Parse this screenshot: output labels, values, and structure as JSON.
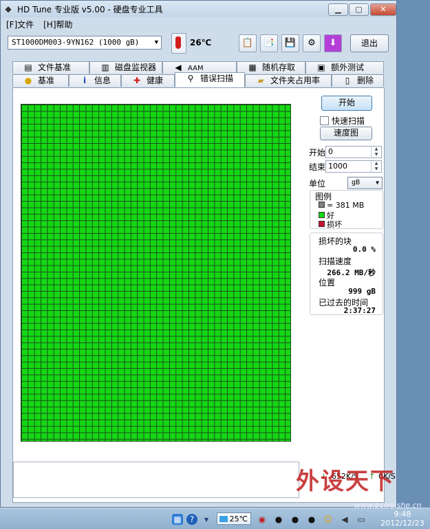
{
  "window": {
    "title": "HD Tune 专业版 v5.00 - 硬盘专业工具",
    "min_label": "▁",
    "max_label": "▢",
    "close_label": "✕"
  },
  "menu": [
    {
      "label": "[F]文件"
    },
    {
      "label": "[H]帮助"
    }
  ],
  "toolbar": {
    "drive": "ST1000DM003-9YN162 (1000 gB)",
    "temperature": "26℃",
    "exit_label": "退出"
  },
  "tabs_row1": [
    {
      "label": "文件基准",
      "icon": "document-icon"
    },
    {
      "label": "磁盘监视器",
      "icon": "chart-icon"
    },
    {
      "label": "AAM",
      "icon": "speaker-icon"
    },
    {
      "label": "随机存取",
      "icon": "random-access-icon"
    },
    {
      "label": "额外测试",
      "icon": "extra-tests-icon"
    }
  ],
  "tabs_row2": [
    {
      "label": "基准",
      "icon": "lightbulb-icon"
    },
    {
      "label": "信息",
      "icon": "info-icon"
    },
    {
      "label": "健康",
      "icon": "health-cross-icon"
    },
    {
      "label": "错误扫描",
      "icon": "magnifier-icon",
      "active": true
    },
    {
      "label": "文件夹占用率",
      "icon": "folder-icon"
    },
    {
      "label": "删除",
      "icon": "trash-icon"
    }
  ],
  "scan": {
    "start_button": "开始",
    "quick_scan_label": "快速扫描",
    "quick_scan_checked": false,
    "speed_map_button": "速度图",
    "start_label": "开始",
    "start_value": "0",
    "end_label": "结束",
    "end_value": "1000",
    "unit_label": "单位",
    "unit_value": "gB"
  },
  "legend": {
    "title": "图例",
    "block_size": "= 381 MB",
    "good": "好",
    "damaged": "损坏",
    "colors": {
      "block": "#808080",
      "good": "#14d814",
      "damaged": "#c8102e"
    }
  },
  "stats": {
    "damaged_blocks_label": "损坏的块",
    "damaged_blocks_value": "0.0 %",
    "scan_speed_label": "扫描速度",
    "scan_speed_value": "266.2 MB/秒",
    "position_label": "位置",
    "position_value": "999 gB",
    "elapsed_label": "已过去的时间",
    "elapsed_value": "2:37:27"
  },
  "status": {
    "down_speed": "652K/S",
    "up_speed": "0K/S"
  },
  "watermark": {
    "text": "外设天下",
    "url": "www.pcwaishe.cn"
  },
  "taskbar": {
    "temperature": "25℃",
    "time": "9:48",
    "date": "2012/12/23"
  }
}
